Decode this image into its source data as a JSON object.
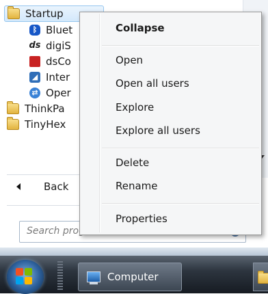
{
  "program_list": {
    "selected_folder": "Startup",
    "startup_items": [
      "Bluet",
      "digiS",
      "dsCo",
      "Inter",
      "Oper"
    ],
    "folders": [
      "ThinkPa",
      "TinyHex"
    ]
  },
  "back_label": "Back",
  "search": {
    "placeholder": "Search programs and files"
  },
  "context_menu": {
    "default_item": "Collapse",
    "group1": [
      "Open",
      "Open all users",
      "Explore",
      "Explore all users"
    ],
    "group2": [
      "Delete",
      "Rename"
    ],
    "group3": [
      "Properties"
    ]
  },
  "taskbar": {
    "task_label": "Computer"
  },
  "icons": {
    "folder": "folder-icon",
    "bluetooth": "bluetooth-icon",
    "digisign": "ds-logo-icon",
    "dscompanion": "app-icon",
    "internet": "internet-icon",
    "opera": "opera-icon",
    "back": "back-arrow-icon",
    "search": "search-icon",
    "start": "windows-start-icon",
    "computer": "computer-icon"
  },
  "colors": {
    "menu_bg": "#f5f6f7",
    "selection": "#d3e8fb",
    "taskbar": "#2d353f"
  }
}
